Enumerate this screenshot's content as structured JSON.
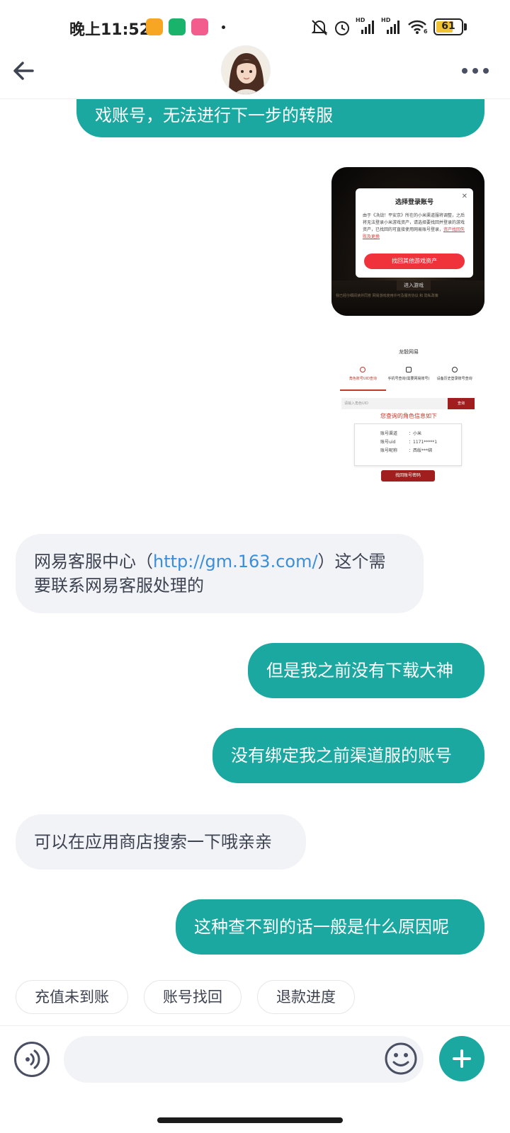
{
  "status_bar": {
    "time": "晚上11:52",
    "battery": "61",
    "network_label": "HD",
    "wifi_label": "6"
  },
  "header": {
    "avatar_alt": "客服头像"
  },
  "messages": [
    {
      "side": "right",
      "text": "戏账号，无法进行下一步的转服"
    },
    {
      "side": "left",
      "text_before": "网易客服中心（",
      "link": "http://gm.163.com/",
      "text_after": "）这个需",
      "line2": "要联系网易客服处理的"
    },
    {
      "side": "right",
      "text": "但是我之前没有下载大神"
    },
    {
      "side": "right",
      "text": "没有绑定我之前渠道服的账号"
    },
    {
      "side": "left",
      "text": "可以在应用商店搜索一下哦亲亲"
    },
    {
      "side": "right",
      "text": "这种查不到的话一般是什么原因呢"
    }
  ],
  "image1": {
    "dialog_title": "选择登录账号",
    "dialog_body": "由于《决战！平安京》所在的小米渠道服将调整，之后将无法登录小米游戏资产，请选择要找回并登录的游戏资产，已找回的可直接使用网易账号登录，",
    "dialog_link": "资产找回失败及更换",
    "dialog_button": "找回其他游戏资产",
    "enter_game": "进入游戏",
    "fine_print": "我已经仔细阅读并同意 网易游戏使用许可及服务协议 和 隐私政策"
  },
  "image2": {
    "title": "龙骰网易",
    "tabs": [
      "角色账号UID查询",
      "手机号查询(需要网易账号)",
      "设备历史登录账号查询"
    ],
    "input_placeholder": "请输入角色UID",
    "query_button": "查询",
    "result_title": "您查询的角色信息如下",
    "rows": [
      {
        "key": "账号渠道",
        "value": "：小米"
      },
      {
        "key": "账号uid",
        "value": "：1171*****1"
      },
      {
        "key": "账号昵称",
        "value": "：西绥***绑"
      }
    ],
    "recover_button": "找回账号密码"
  },
  "quick_replies": [
    "充值未到账",
    "账号找回",
    "退款进度"
  ],
  "input": {
    "placeholder": ""
  },
  "colors": {
    "accent": "#1aa8a0",
    "bubble_left": "#f1f3f6",
    "link": "#3b8ed9"
  }
}
